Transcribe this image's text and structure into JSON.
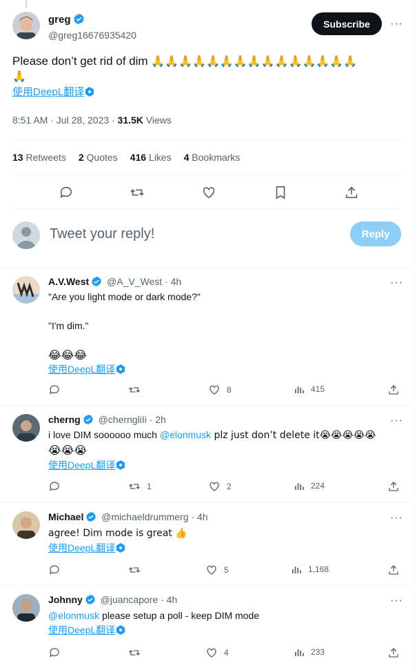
{
  "main_tweet": {
    "author_name": "greg",
    "author_handle": "@greg16676935420",
    "subscribe_label": "Subscribe",
    "text": "Please don’t get rid of dim",
    "emoji_line": "🙏🙏🙏🙏🙏🙏🙏🙏🙏🙏🙏🙏🙏🙏🙏",
    "emoji_line2": "🙏",
    "translate": "使用DeepL翻译",
    "time": "8:51 AM · Jul 28, 2023 · ",
    "views_count": "31.5K",
    "views_label": " Views",
    "retweets_count": "13",
    "retweets_label": " Retweets",
    "quotes_count": "2",
    "quotes_label": " Quotes",
    "likes_count": "416",
    "likes_label": " Likes",
    "bookmarks_count": "4",
    "bookmarks_label": " Bookmarks"
  },
  "composer": {
    "placeholder": "Tweet your reply!",
    "reply_label": "Reply"
  },
  "replies": [
    {
      "name": "A.V.West",
      "handle": "@A_V_West",
      "time": "· 4h",
      "lines": [
        "\"Are you light mode or dark mode?\"",
        "\"I'm dim.\"",
        "😂😂😂"
      ],
      "translate": "使用DeepL翻译",
      "retweets": "",
      "likes": "8",
      "views": "415"
    },
    {
      "name": "cherng",
      "handle": "@cherngliIi",
      "time": "· 2h",
      "text_before": "i love DIM soooooo much ",
      "mention": "@elonmusk",
      "text_after": " plz just don’t delete it😭😭😭😭😭",
      "text_line2": "😭😭😭",
      "translate": "使用DeepL翻译",
      "retweets": "1",
      "likes": "2",
      "views": "224"
    },
    {
      "name": "Michael",
      "handle": "@michaeldrummerg",
      "time": "· 4h",
      "text": "agree! Dim mode is great 👍",
      "translate": "使用DeepL翻译",
      "retweets": "",
      "likes": "5",
      "views": "1,168"
    },
    {
      "name": "Johnny",
      "handle": "@juancapore",
      "time": "· 4h",
      "mention": "@elonmusk",
      "text_after": " please setup a poll - keep DIM mode",
      "translate": "使用DeepL翻译",
      "retweets": "",
      "likes": "4",
      "views": "233"
    }
  ]
}
